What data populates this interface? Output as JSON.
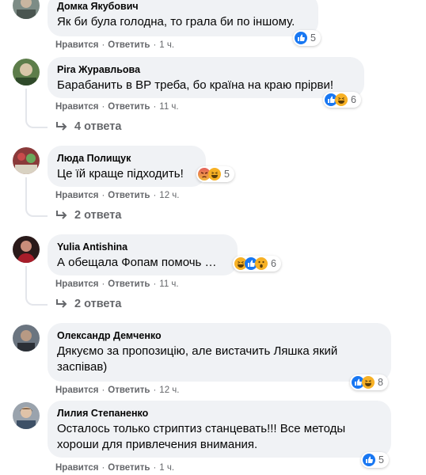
{
  "ui": {
    "like_label": "Нравится",
    "reply_label": "Ответить",
    "separator": "·",
    "colors": {
      "bubble_bg": "#f0f2f5",
      "meta_text": "#65676b",
      "like_blue": "#1877f2",
      "haha_yellow": "#f7b125",
      "angry_red": "#e4605c"
    }
  },
  "comments": [
    {
      "author": "Домка Якубович",
      "text": "Як би була голодна, то грала би по іншому.",
      "time": "1 ч.",
      "reactions": [
        "like-icon"
      ],
      "reaction_count": "5"
    },
    {
      "author": "Pira Журавльова",
      "text": "Барабанить в ВР треба, бо країна на краю прірви!",
      "time": "11 ч.",
      "reactions": [
        "like-icon",
        "haha-icon"
      ],
      "reaction_count": "6",
      "replies": "4 ответа"
    },
    {
      "author": "Люда Полищук",
      "text": "Це їй краще підходить!",
      "time": "12 ч.",
      "reactions": [
        "angry-icon",
        "haha-icon"
      ],
      "reaction_count": "5",
      "replies": "2 ответа"
    },
    {
      "author": "Yulia Antishina",
      "text": "А обещала Фопам помочь …",
      "time": "11 ч.",
      "reactions": [
        "haha-icon",
        "like-icon",
        "wow-icon"
      ],
      "reaction_count": "6",
      "replies": "2 ответа"
    },
    {
      "author": "Олександр Демченко",
      "text": "Дякуємо за пропозицію, але вистачить Ляшка який заспівав)",
      "time": "12 ч.",
      "reactions": [
        "like-icon",
        "haha-icon"
      ],
      "reaction_count": "8"
    },
    {
      "author": "Лилия Степаненко",
      "text": "Осталось только стриптиз станцевать!!! Все методы хороши для привлечения внимания.",
      "time": "1 ч.",
      "reactions": [
        "like-icon"
      ],
      "reaction_count": "5"
    }
  ]
}
